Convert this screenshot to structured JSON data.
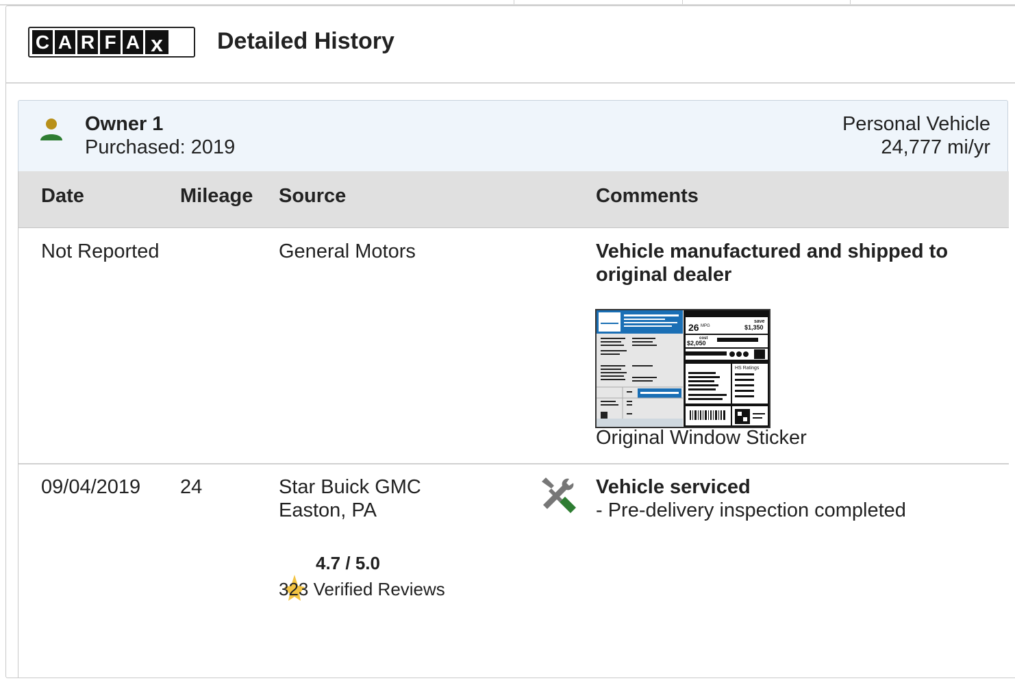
{
  "brand": {
    "logo_letters": [
      "C",
      "A",
      "R",
      "F",
      "A",
      "X"
    ],
    "logo_label": "CARFAX"
  },
  "header": {
    "title": "Detailed History"
  },
  "owner": {
    "name": "Owner 1",
    "purchased": "Purchased: 2019",
    "type": "Personal Vehicle",
    "miles_per_year": "24,777 mi/yr",
    "icon": "person-icon"
  },
  "table": {
    "columns": {
      "date": "Date",
      "mileage": "Mileage",
      "source": "Source",
      "comments": "Comments"
    },
    "rows": [
      {
        "date": "Not Reported",
        "mileage": "",
        "source_line1": "General Motors",
        "comment_title": "Vehicle manufactured and shipped to original dealer",
        "sticker_caption": "Original Window Sticker"
      },
      {
        "date": "09/04/2019",
        "mileage": "24",
        "source_line1": "Star Buick GMC",
        "source_line2": "Easton, PA",
        "rating": "4.7 / 5.0",
        "reviews": "323 Verified Reviews",
        "comment_title": "Vehicle serviced",
        "comment_detail": "- Pre-delivery inspection completed",
        "icon": "wrench-screwdriver-icon"
      }
    ]
  },
  "sticker": {
    "mpg": "26",
    "mpg_unit": "MPG",
    "save_label": "save",
    "save_value": "$1,350",
    "cost_label": "cost",
    "cost_value": "$2,050",
    "ratings_label": "HS Ratings"
  },
  "colors": {
    "owner_bg": "#eff5fb",
    "header_bg": "#e0e0e0",
    "person_head": "#b8901a",
    "person_body": "#2e7d32",
    "star": "#f3c443",
    "wrench_green": "#2e7d32"
  }
}
